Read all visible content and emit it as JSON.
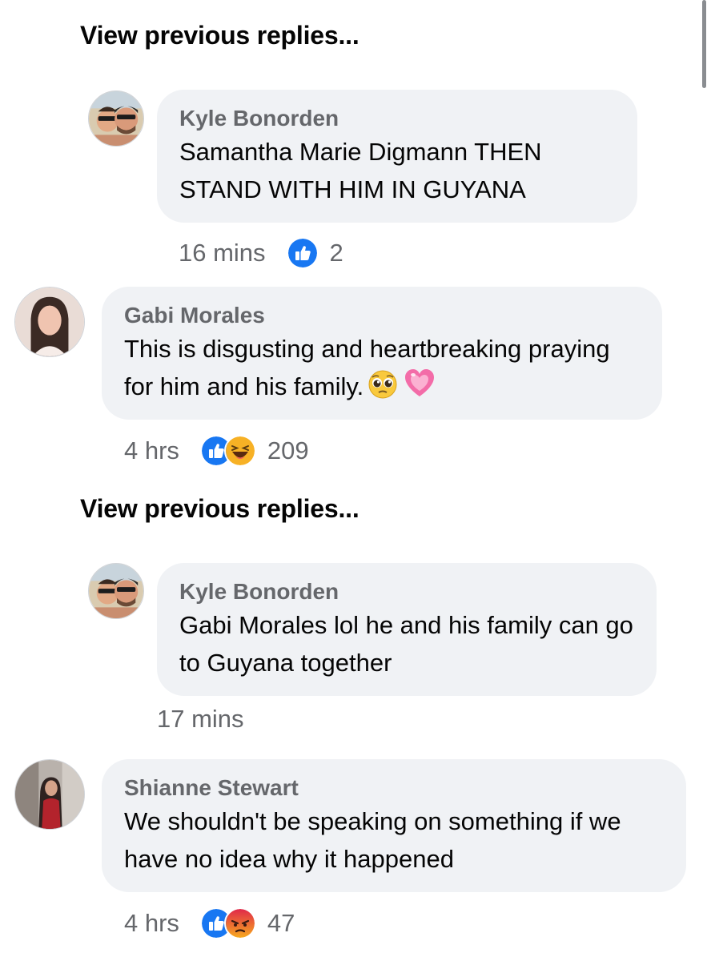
{
  "view_previous_label": "View previous replies...",
  "threads": [
    {
      "reply": {
        "author": "Kyle Bonorden",
        "text": "Samantha Marie Digmann THEN STAND WITH HIM IN GUYANA",
        "time": "16 mins",
        "reactions": [
          "like"
        ],
        "reaction_count": "2"
      },
      "comment": {
        "author": "Gabi Morales",
        "text": "This is disgusting and heartbreaking praying for him and his family.",
        "emojis": [
          "pleading-face",
          "growing-heart"
        ],
        "time": "4 hrs",
        "reactions": [
          "like",
          "haha"
        ],
        "reaction_count": "209"
      }
    },
    {
      "reply": {
        "author": "Kyle Bonorden",
        "text": "Gabi Morales lol he and his family can go to Guyana together",
        "time": "17 mins"
      },
      "comment": {
        "author": "Shianne Stewart",
        "text": "We shouldn't be speaking on something if we have no idea why it happened",
        "time": "4 hrs",
        "reactions": [
          "like",
          "angry"
        ],
        "reaction_count": "47"
      }
    }
  ],
  "colors": {
    "bubble": "#f0f2f5",
    "meta_text": "#65676b",
    "like_blue": "#1877f2",
    "haha_yellow": "#f7b125",
    "angry_red": "#e9710f"
  }
}
